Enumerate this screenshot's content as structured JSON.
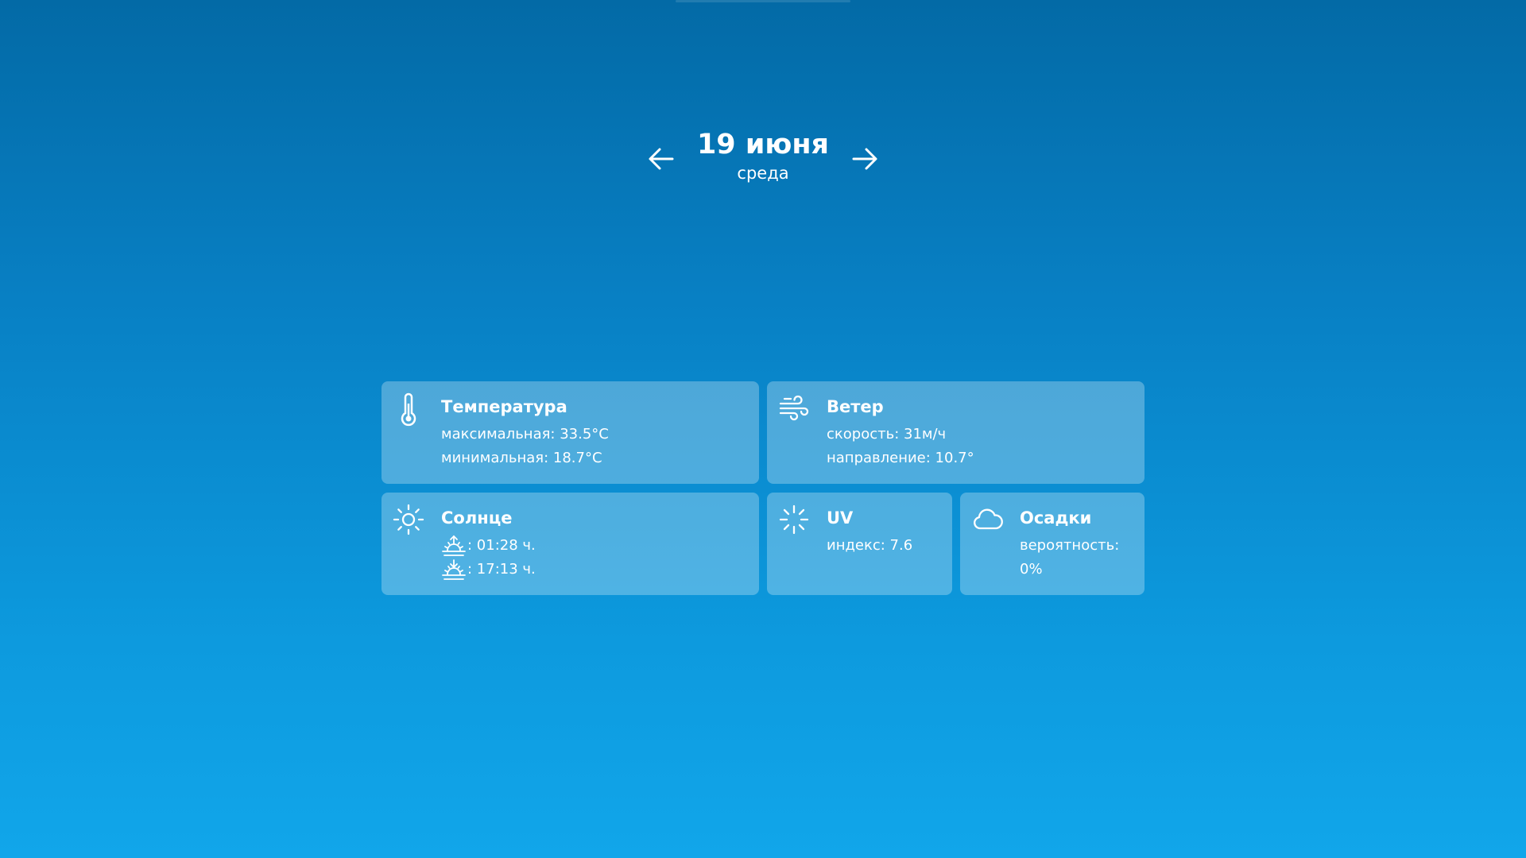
{
  "date": {
    "title": "19 июня",
    "weekday": "среда"
  },
  "cards": {
    "temperature": {
      "title": "Температура",
      "max": "максимальная: 33.5°C",
      "min": "минимальная: 18.7°C",
      "icon": "thermometer-icon"
    },
    "wind": {
      "title": "Ветер",
      "speed": "скорость: 31м/ч",
      "direction": "направление: 10.7°",
      "icon": "wind-icon"
    },
    "sun": {
      "title": "Солнце",
      "sunrise": ": 01:28 ч.",
      "sunset": ": 17:13 ч.",
      "icon": "sun-icon"
    },
    "uv": {
      "title": "UV",
      "index": "индекс: 7.6",
      "icon": "uv-icon"
    },
    "precipitation": {
      "title": "Осадки",
      "probability": "вероятность: 0%",
      "icon": "cloud-icon"
    }
  },
  "colors": {
    "background_top": "#036aa6",
    "background_bottom": "#11a6ea",
    "card": "rgba(255,255,255,0.28)",
    "text": "#ffffff"
  }
}
